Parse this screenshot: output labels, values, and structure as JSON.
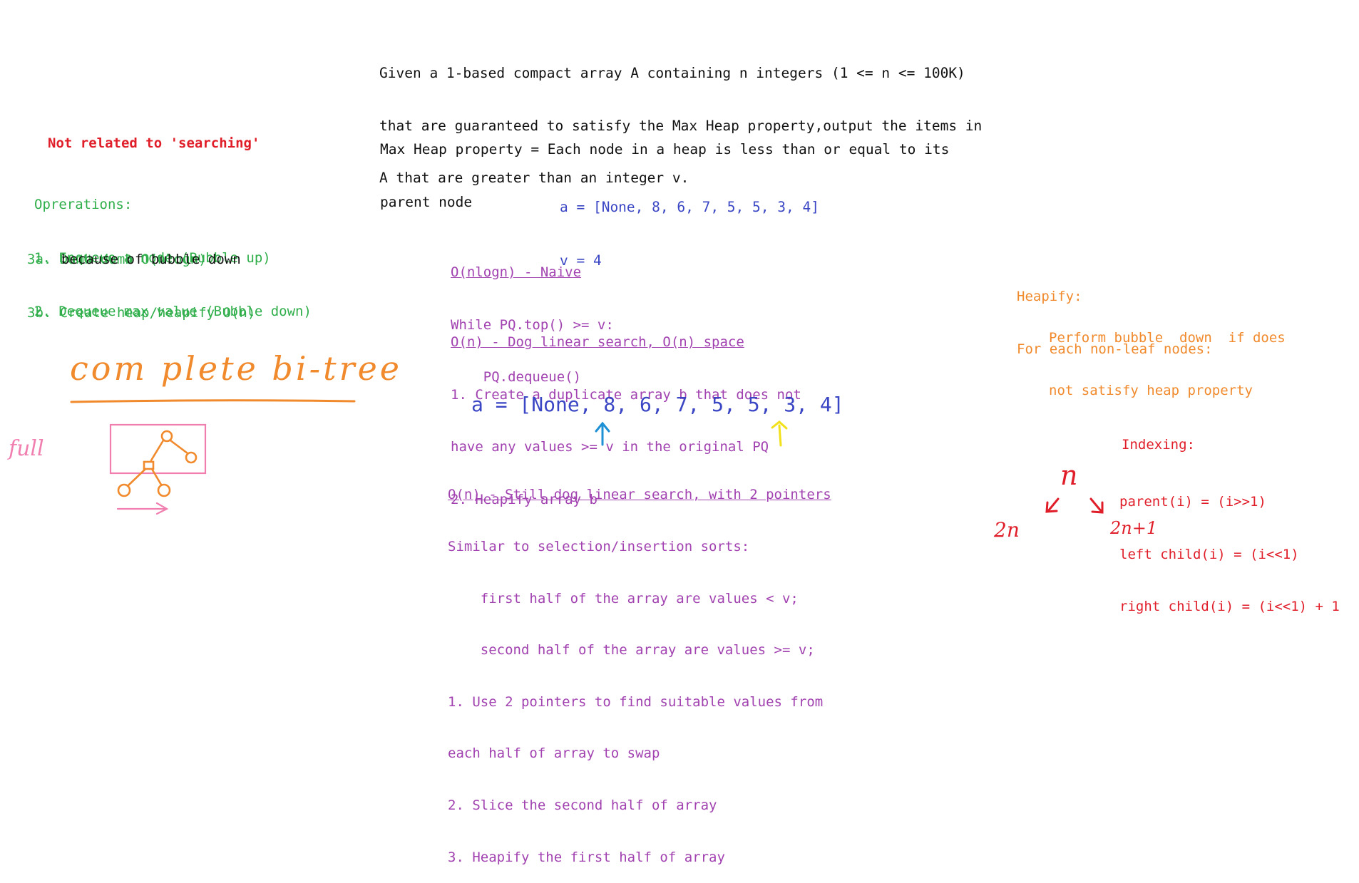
{
  "problem": {
    "statement": [
      "Given a 1-based compact array A containing n integers (1 <= n <= 100K)",
      "that are guaranteed to satisfy the Max Heap property,output the items in",
      "A that are greater than an integer v."
    ],
    "property": [
      "Max Heap property = Each node in a heap is less than or equal to its",
      "parent node"
    ],
    "example": [
      "a = [None, 8, 6, 7, 5, 5, 3, 4]",
      "v = 4"
    ]
  },
  "left_notes": {
    "not_related": "Not related to 'searching'",
    "operations": [
      "Oprerations:",
      "1. Enqueue a node (Bubble up)",
      "2. Dequeue max value (Bubble down)"
    ],
    "ops_3": [
      "3a. Dumb dumb O(nlogn)",
      "3b. Create heap/heapify O(n)"
    ],
    "ops_3_note": "because of bubble down"
  },
  "approaches": {
    "naive": {
      "title": "O(nlogn) - Naive",
      "lines": [
        "While PQ.top() >= v:",
        "    PQ.dequeue()"
      ]
    },
    "linear": {
      "title": "O(n) - Dog linear search, O(n) space",
      "lines": [
        "1. Create a duplicate array b that does not",
        "have any values >= v in the original PQ",
        "2. Heapify array b"
      ]
    },
    "big_array": "a = [None, 8, 6, 7, 5, 5, 3, 4]",
    "two_pointers": {
      "title": "O(n) - Still dog linear search, with 2 pointers",
      "lines": [
        "Similar to selection/insertion sorts:",
        "    first half of the array are values < v;",
        "    second half of the array are values >= v;",
        "1. Use 2 pointers to find suitable values from",
        "each half of array to swap",
        "2. Slice the second half of array",
        "3. Heapify the first half of array"
      ]
    }
  },
  "right_notes": {
    "heapify": [
      "Heapify:",
      "For each non-leaf nodes:"
    ],
    "heapify_body": [
      "Perform bubble  down  if does",
      "not satisfy heap property"
    ],
    "indexing_title": "Indexing:",
    "indexing": [
      "parent(i) = (i>>1)",
      "left child(i) = (i<<1)",
      "right child(i) = (i<<1) + 1"
    ]
  },
  "handwriting": {
    "complete_bitree": "com plete   bi-tree",
    "full": "full",
    "n": "n",
    "two_n": "2n",
    "two_n_plus_one": "2n+1"
  },
  "colors": {
    "black": "#111111",
    "blue": "#3a46c4",
    "red": "#e01e2a",
    "green": "#2fae4a",
    "purple": "#a142b0",
    "orange": "#f08a2c",
    "pink": "#f07fb0",
    "cyan": "#1e90d6",
    "yellow": "#f2e11a"
  }
}
